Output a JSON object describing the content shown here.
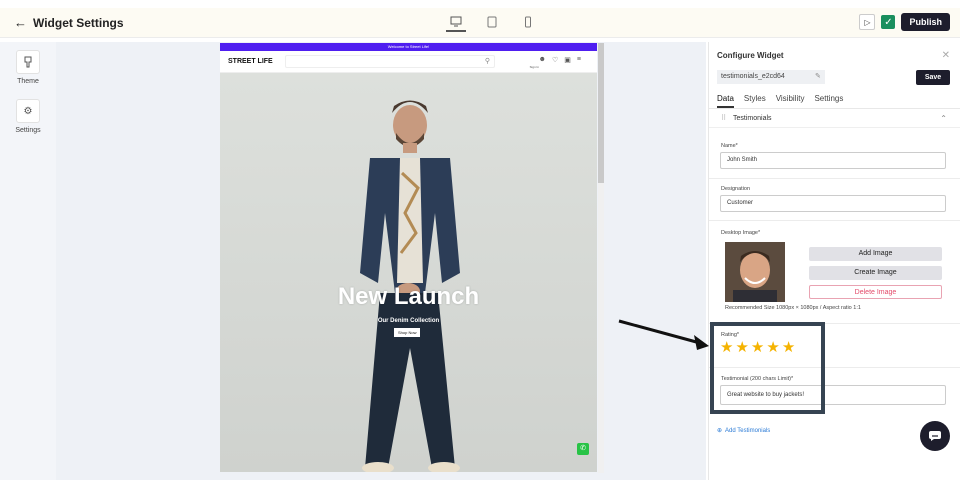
{
  "topbar": {
    "title": "Widget Settings",
    "publish_label": "Publish"
  },
  "leftrail": {
    "items": [
      {
        "label": "Theme",
        "icon": "theme-icon"
      },
      {
        "label": "Settings",
        "icon": "gear-icon"
      }
    ]
  },
  "preview": {
    "promo_text": "Welcome to Street Life!",
    "brand": "STREET LIFE",
    "signin_text": "Sign In",
    "hero_title": "New Launch",
    "hero_subtitle": "Our Denim Collection",
    "hero_button": "Shop Now"
  },
  "panel": {
    "title": "Configure Widget",
    "widget_id": "testimonials_e2cd64",
    "save_label": "Save",
    "tabs": [
      "Data",
      "Styles",
      "Visibility",
      "Settings"
    ],
    "section_label": "Testimonials",
    "name_label": "Name*",
    "name_value": "John Smith",
    "designation_label": "Designation",
    "designation_value": "Customer",
    "desktop_image_label": "Desktop Image*",
    "add_image_label": "Add Image",
    "create_image_label": "Create Image",
    "delete_image_label": "Delete Image",
    "recommended_size": "Recommended Size 1080px × 1080px / Aspect ratio 1:1",
    "rating_label": "Rating*",
    "rating_value": 5,
    "testimonial_label": "Testimonial (200 chars Limit)*",
    "testimonial_value": "Great website to buy jackets!",
    "add_testimonials_label": "Add Testimonials"
  },
  "colors": {
    "promo_bar": "#4f1ef0",
    "publish_bg": "#1d1d2c",
    "star": "#f5b301",
    "delete_text": "#e34b6a",
    "link": "#2b7bd6"
  }
}
